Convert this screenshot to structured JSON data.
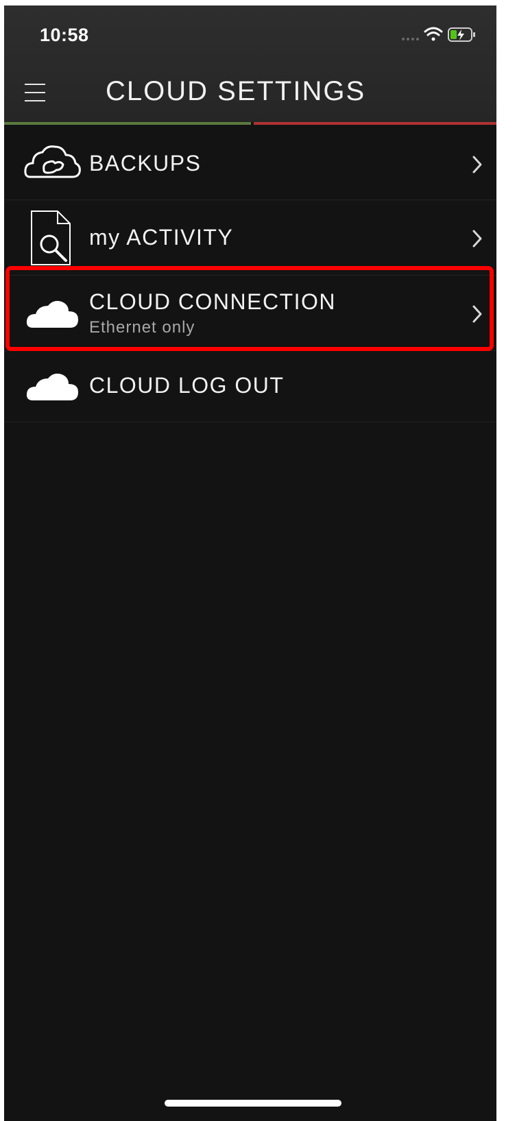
{
  "status_bar": {
    "time": "10:58",
    "icons": [
      "signal-dots-icon",
      "wifi-icon",
      "battery-charging-icon"
    ]
  },
  "header": {
    "menu_icon": "hamburger-menu-icon",
    "title": "CLOUD SETTINGS",
    "accent_colors": [
      "#5b7a3e",
      "#b23232"
    ]
  },
  "menu": {
    "items": [
      {
        "label": "BACKUPS",
        "icon": "cloud-backup-icon",
        "chevron": "chevron-right-icon"
      },
      {
        "label": "my ACTIVITY",
        "icon": "document-search-icon",
        "chevron": "chevron-right-icon"
      },
      {
        "label": "CLOUD CONNECTION",
        "sublabel": "Ethernet only",
        "icon": "cloud-icon",
        "chevron": "chevron-right-icon",
        "highlighted": true
      },
      {
        "label": "CLOUD LOG OUT",
        "icon": "cloud-icon"
      }
    ]
  },
  "highlight_color": "#ff0000"
}
